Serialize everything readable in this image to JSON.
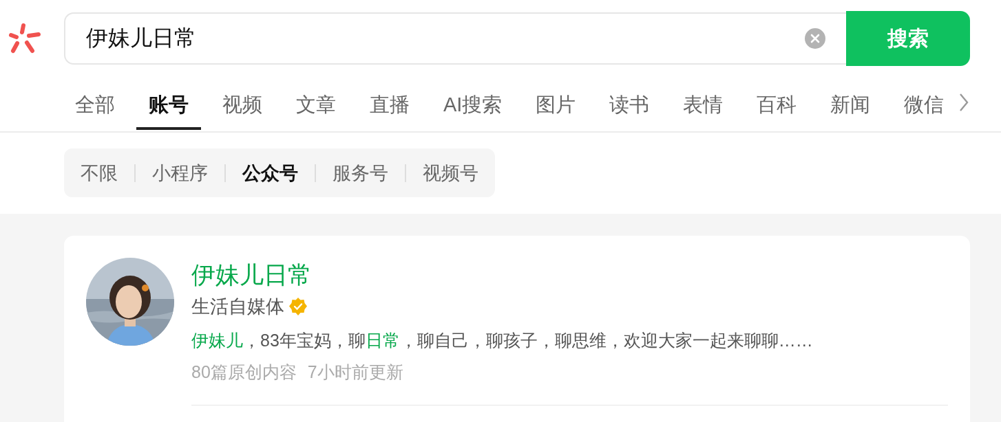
{
  "search": {
    "value": "伊妹儿日常",
    "button": "搜索"
  },
  "tabs": [
    {
      "label": "全部",
      "selected": false
    },
    {
      "label": "账号",
      "selected": true
    },
    {
      "label": "视频",
      "selected": false
    },
    {
      "label": "文章",
      "selected": false
    },
    {
      "label": "直播",
      "selected": false
    },
    {
      "label": "AI搜索",
      "selected": false
    },
    {
      "label": "图片",
      "selected": false
    },
    {
      "label": "读书",
      "selected": false
    },
    {
      "label": "表情",
      "selected": false
    },
    {
      "label": "百科",
      "selected": false
    },
    {
      "label": "新闻",
      "selected": false
    },
    {
      "label": "微信",
      "selected": false
    }
  ],
  "filters": [
    {
      "label": "不限",
      "selected": false
    },
    {
      "label": "小程序",
      "selected": false
    },
    {
      "label": "公众号",
      "selected": true
    },
    {
      "label": "服务号",
      "selected": false
    },
    {
      "label": "视频号",
      "selected": false
    }
  ],
  "results": [
    {
      "name": "伊妹儿日常",
      "category": "生活自媒体",
      "verified": true,
      "description": [
        {
          "text": "伊妹儿",
          "highlight": true
        },
        {
          "text": "，83年宝妈，聊",
          "highlight": false
        },
        {
          "text": "日常",
          "highlight": true
        },
        {
          "text": "，聊自己，聊孩子，聊思维，欢迎大家一起来聊聊……",
          "highlight": false
        }
      ],
      "meta": [
        "80篇原创内容",
        "7小时前更新"
      ]
    }
  ]
}
